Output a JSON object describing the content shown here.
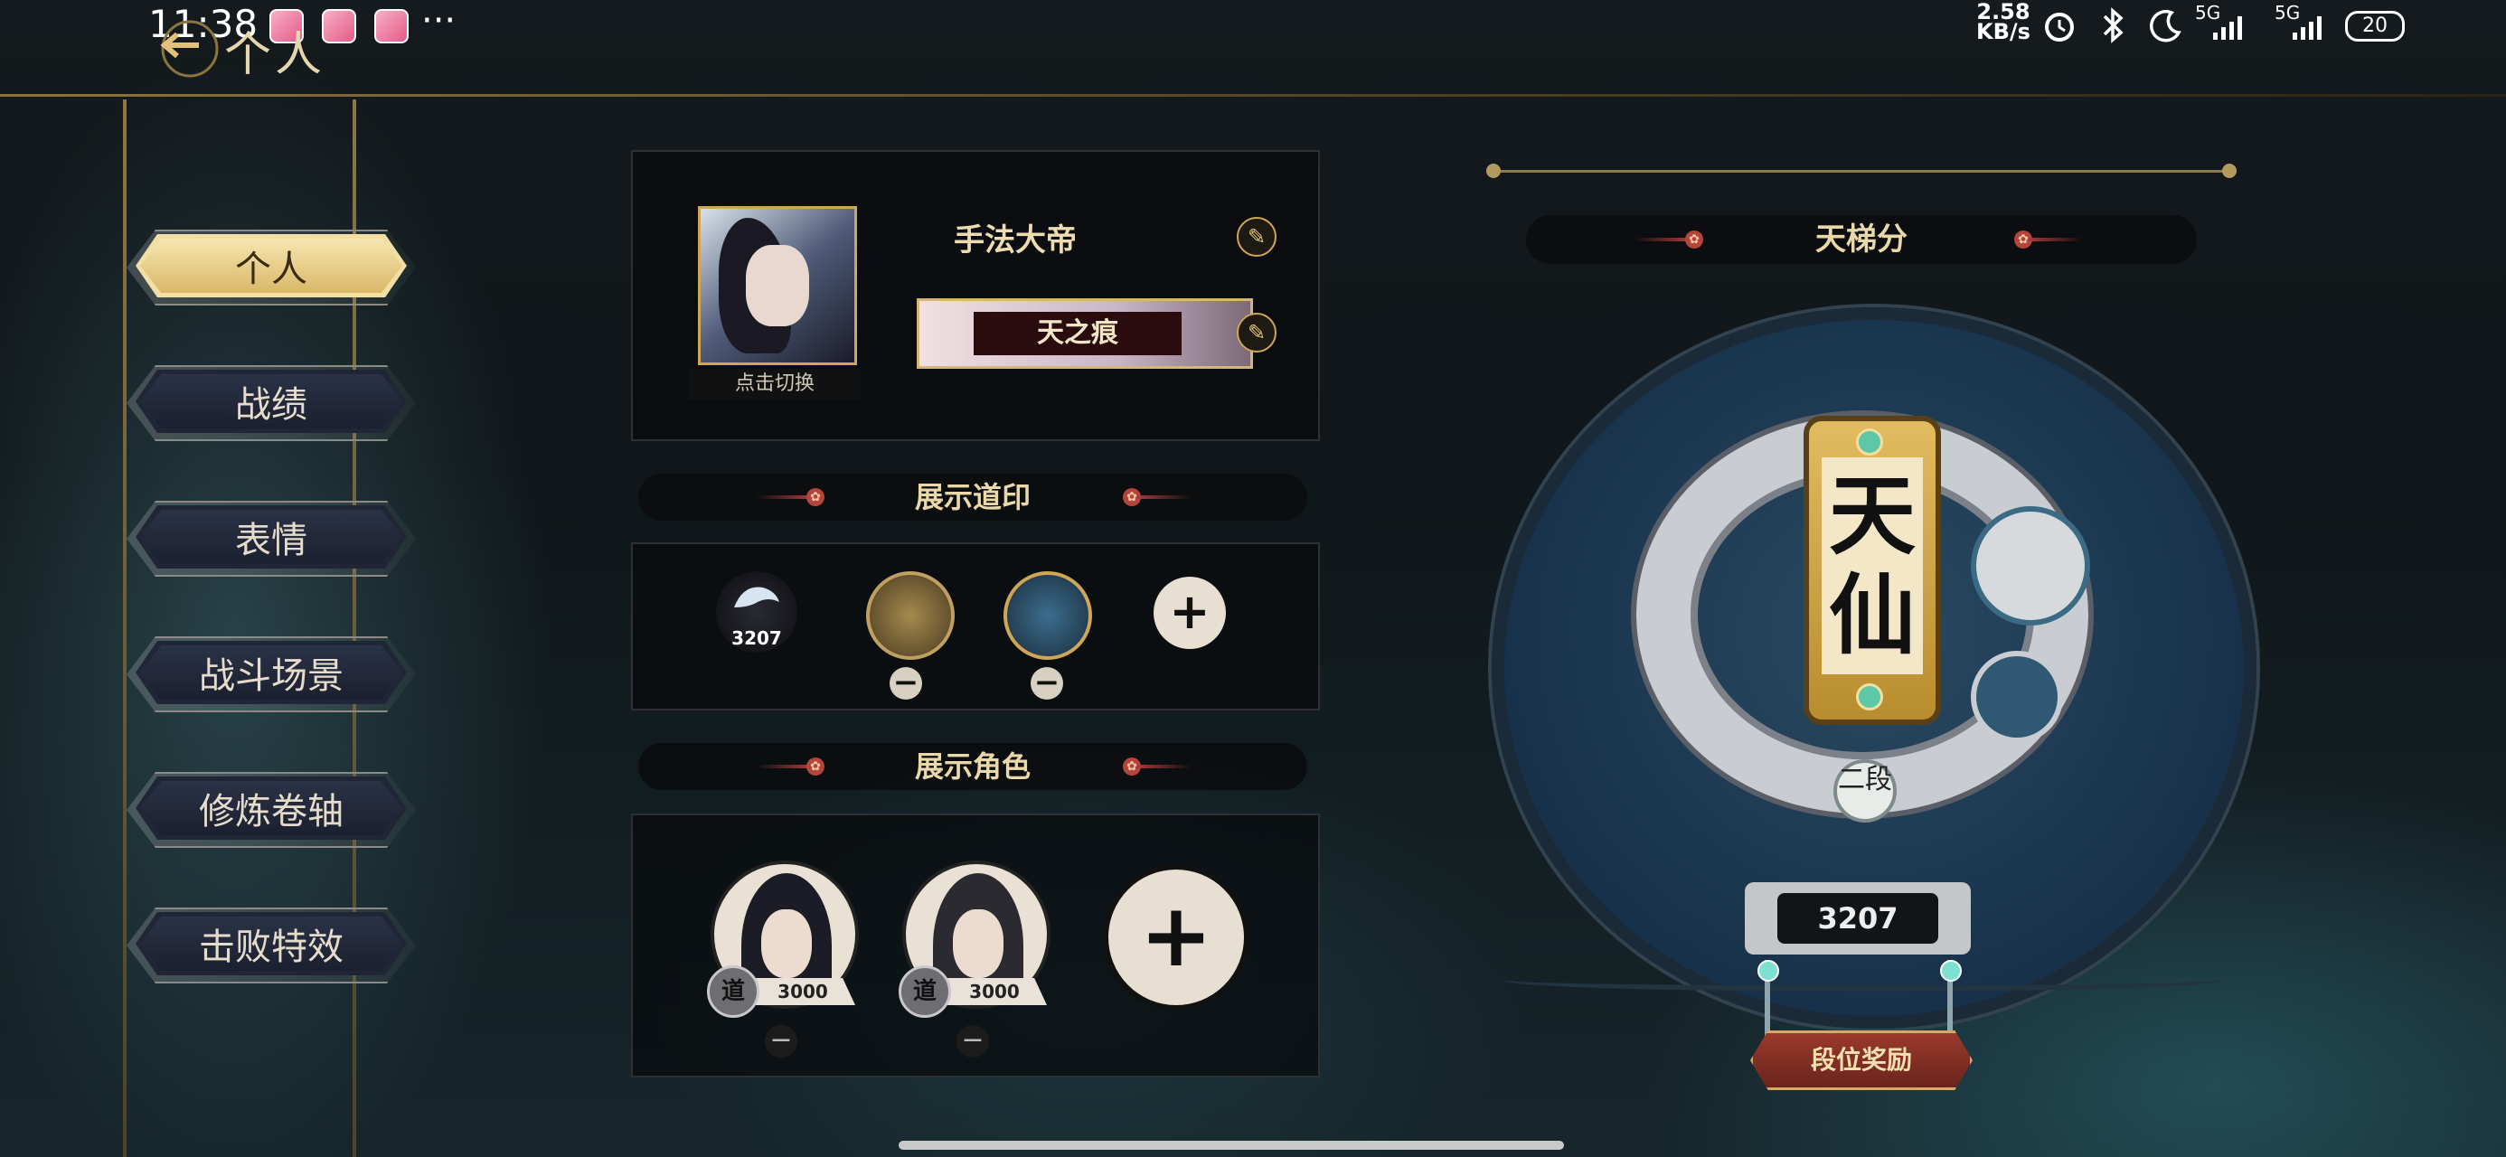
{
  "status_bar": {
    "time": "11:38",
    "more": "···",
    "net_speed_value": "2.58",
    "net_speed_unit": "KB/s",
    "sim1": "5G",
    "sim2": "5G",
    "battery": "20"
  },
  "header": {
    "title": "个人"
  },
  "sidebar": {
    "items": [
      {
        "label": "个人",
        "active": true
      },
      {
        "label": "战绩",
        "active": false
      },
      {
        "label": "表情",
        "active": false
      },
      {
        "label": "战斗场景",
        "active": false
      },
      {
        "label": "修炼卷轴",
        "active": false
      },
      {
        "label": "击败特效",
        "active": false
      }
    ]
  },
  "profile": {
    "switch_label": "点击切换",
    "nickname": "手法大帝",
    "title_badge": "天之痕",
    "edit_icon": "✎"
  },
  "sections": {
    "seals_header": "展示道印",
    "characters_header": "展示角色"
  },
  "seals": [
    {
      "icon": "dragon-seal-icon",
      "label": "3207"
    },
    {
      "icon": "sword-seal-icon",
      "label": ""
    },
    {
      "icon": "serpent-seal-icon",
      "label": ""
    }
  ],
  "characters": [
    {
      "score": "3000",
      "rank_glyph": "道"
    },
    {
      "score": "3000",
      "rank_glyph": "道"
    }
  ],
  "ladder": {
    "header": "天梯分",
    "rank_name_top": "天",
    "rank_name_bottom": "仙",
    "tier": "二段",
    "score": "3207",
    "reward_button": "段位奖励"
  },
  "colors": {
    "accent_gold": "#d6b770",
    "active_tab": "#f1dfa4",
    "reward_red": "#9a3a2c"
  }
}
